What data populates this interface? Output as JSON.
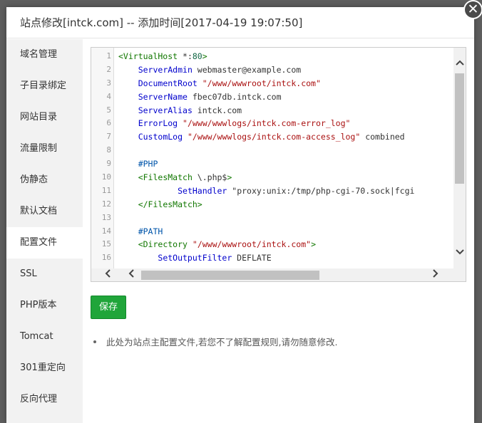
{
  "dialog": {
    "title": "站点修改[intck.com] -- 添加时间[2017-04-19 19:07:50]",
    "close_symbol": "✕"
  },
  "sidebar": {
    "items": [
      {
        "label": "域名管理"
      },
      {
        "label": "子目录绑定"
      },
      {
        "label": "网站目录"
      },
      {
        "label": "流量限制"
      },
      {
        "label": "伪静态"
      },
      {
        "label": "默认文档"
      },
      {
        "label": "配置文件"
      },
      {
        "label": "SSL"
      },
      {
        "label": "PHP版本"
      },
      {
        "label": "Tomcat"
      },
      {
        "label": "301重定向"
      },
      {
        "label": "反向代理"
      }
    ],
    "active_index": 6
  },
  "editor": {
    "line_numbers": [
      "1",
      "2",
      "3",
      "4",
      "5",
      "6",
      "7",
      "8",
      "9",
      "10",
      "11",
      "12",
      "13",
      "14",
      "15",
      "16"
    ],
    "lines": [
      "<VirtualHost *:80>",
      "    ServerAdmin webmaster@example.com",
      "    DocumentRoot \"/www/wwwroot/intck.com\"",
      "    ServerName fbec07db.intck.com",
      "    ServerAlias intck.com",
      "    ErrorLog \"/www/wwwlogs/intck.com-error_log\"",
      "    CustomLog \"/www/wwwlogs/intck.com-access_log\" combined",
      "",
      "    #PHP",
      "    <FilesMatch \\.php$>",
      "            SetHandler \"proxy:unix:/tmp/php-cgi-70.sock|fcgi",
      "    </FilesMatch>",
      "",
      "    #PATH",
      "    <Directory \"/www/wwwroot/intck.com\">",
      "        SetOutputFilter DEFLATE"
    ]
  },
  "scroll_icons": {
    "up": "chevron-up-icon",
    "down": "chevron-down-icon",
    "left": "chevron-left-icon",
    "right": "chevron-right-icon"
  },
  "actions": {
    "save_label": "保存"
  },
  "tips": [
    "此处为站点主配置文件,若您不了解配置规则,请勿随意修改."
  ],
  "colors": {
    "save_button": "#20a53a",
    "sidebar_bg": "#f2f2f2"
  }
}
